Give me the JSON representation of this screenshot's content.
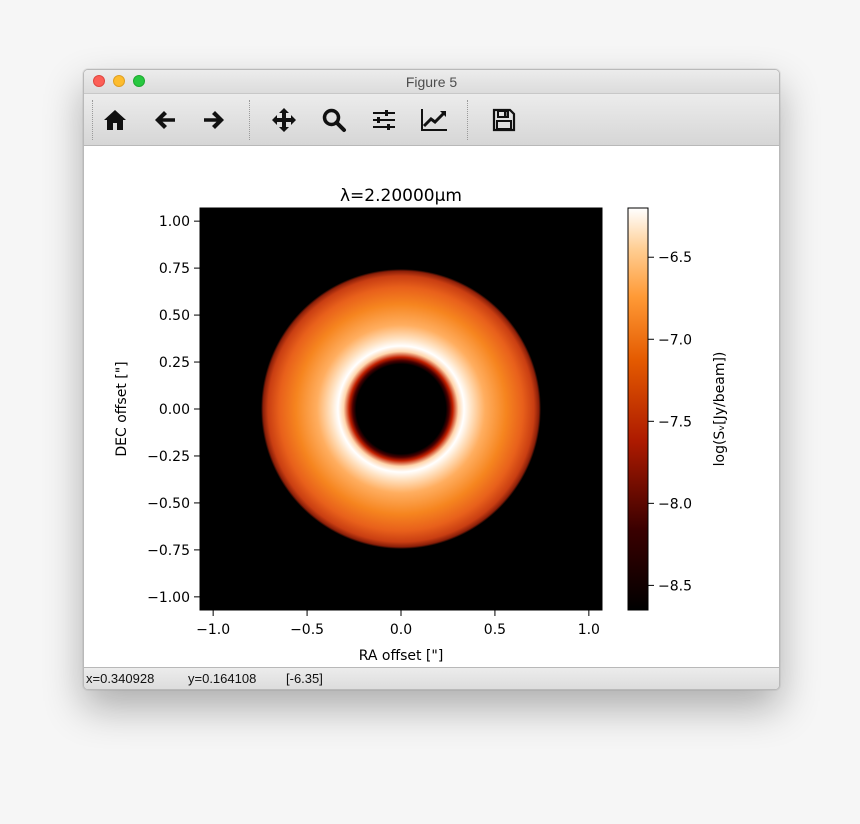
{
  "window": {
    "title": "Figure 5"
  },
  "toolbar": {
    "buttons": [
      {
        "name": "home-icon",
        "label": "Home"
      },
      {
        "name": "back-arrow-icon",
        "label": "Back"
      },
      {
        "name": "forward-arrow-icon",
        "label": "Forward"
      },
      {
        "name": "pan-icon",
        "label": "Pan"
      },
      {
        "name": "zoom-icon",
        "label": "Zoom"
      },
      {
        "name": "subplots-icon",
        "label": "Subplots"
      },
      {
        "name": "edit-axis-icon",
        "label": "Customize"
      },
      {
        "name": "save-icon",
        "label": "Save"
      }
    ]
  },
  "status": {
    "x": "x=0.340928",
    "y": "y=0.164108",
    "value": "[-6.35]"
  },
  "chart_data": {
    "type": "heatmap",
    "title": "λ=2.20000μm",
    "xlabel": "RA offset [\"]",
    "ylabel": "DEC offset [\"]",
    "xlim": [
      -1.07,
      1.07
    ],
    "ylim": [
      -1.07,
      1.07
    ],
    "xticks": [
      -1.0,
      -0.5,
      0.0,
      0.5,
      1.0
    ],
    "xtick_labels": [
      "−1.0",
      "−0.5",
      "0.0",
      "0.5",
      "1.0"
    ],
    "yticks": [
      1.0,
      0.75,
      0.5,
      0.25,
      0.0,
      -0.25,
      -0.5,
      -0.75,
      -1.0
    ],
    "ytick_labels": [
      "1.00",
      "0.75",
      "0.50",
      "0.25",
      "0.00",
      "−0.25",
      "−0.50",
      "−0.75",
      "−1.00"
    ],
    "colormap": "gist_heat",
    "colorbar": {
      "label": "log(Sᵥ[Jy/beam])",
      "range": [
        -8.65,
        -6.2
      ],
      "ticks": [
        -6.5,
        -7.0,
        -7.5,
        -8.0,
        -8.5
      ],
      "tick_labels": [
        "−6.5",
        "−7.0",
        "−7.5",
        "−8.0",
        "−8.5"
      ]
    },
    "ring": {
      "inner_radius": 0.25,
      "outer_radius": 0.74,
      "center": [
        0.0,
        0.0
      ],
      "background": "black"
    },
    "grid": false
  }
}
